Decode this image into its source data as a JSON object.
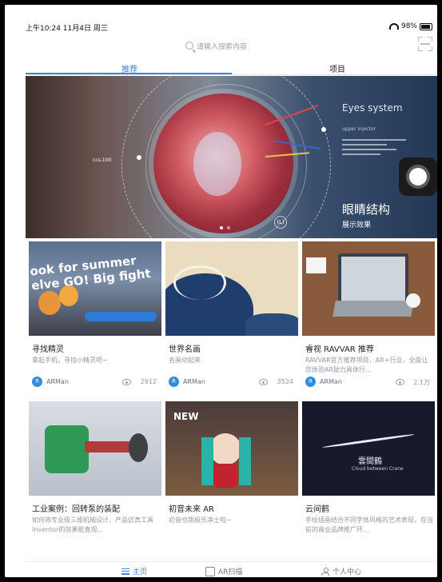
{
  "status_bar": {
    "time_date": "上午10:24 11月4日 周三",
    "battery": "98%"
  },
  "search": {
    "placeholder": "请输入搜索内容"
  },
  "tabs": [
    {
      "label": "推荐",
      "active": true
    },
    {
      "label": "项目",
      "active": false
    }
  ],
  "banner": {
    "title": "眼睛结构",
    "subtitle": "展示效果",
    "eyes_label": "Eyes system",
    "small_label": "upper injector",
    "left_caption": "ccs-100",
    "badge": "(L)",
    "pages": 2,
    "active_page": 1
  },
  "cards": [
    {
      "title": "寻找精灵",
      "desc": "拿起手机，寻找小精灵吧~",
      "author": "ARMan",
      "views": "2912",
      "thumb_text": "ook for summer elve GO! Big fight"
    },
    {
      "title": "世界名画",
      "desc": "名画动起来",
      "author": "ARMan",
      "views": "3524"
    },
    {
      "title": "睿视 RAVVAR 推荐",
      "desc": "RAVVAR官方推荐项目，AR+行业，全面让您体验AR助力具体行...",
      "author": "ARMan",
      "views": "2.1万"
    },
    {
      "title": "工业案例：回转泵的装配",
      "desc": "如何将专业级三维机械设计、产品仿真工具Inventor的效果能直观...",
      "author": "",
      "views": ""
    },
    {
      "title": "初音未来 AR",
      "desc": "初音也跳极乐净土啦~",
      "author": "",
      "views": "",
      "thumb_text": "NEW"
    },
    {
      "title": "云间鹤",
      "desc": "手绘插画结合不同字体风格的艺术表现，在当前的商业品牌推广环...",
      "author": "",
      "views": "",
      "thumb_text": "雲間鶴",
      "thumb_sub": "Cloud between Crane"
    }
  ],
  "bottom_nav": [
    {
      "label": "主页",
      "active": true
    },
    {
      "label": "AR扫描",
      "active": false
    },
    {
      "label": "个人中心",
      "active": false
    }
  ],
  "colors": {
    "accent": "#3b86e6",
    "text": "#222222",
    "muted": "#9199a3"
  }
}
